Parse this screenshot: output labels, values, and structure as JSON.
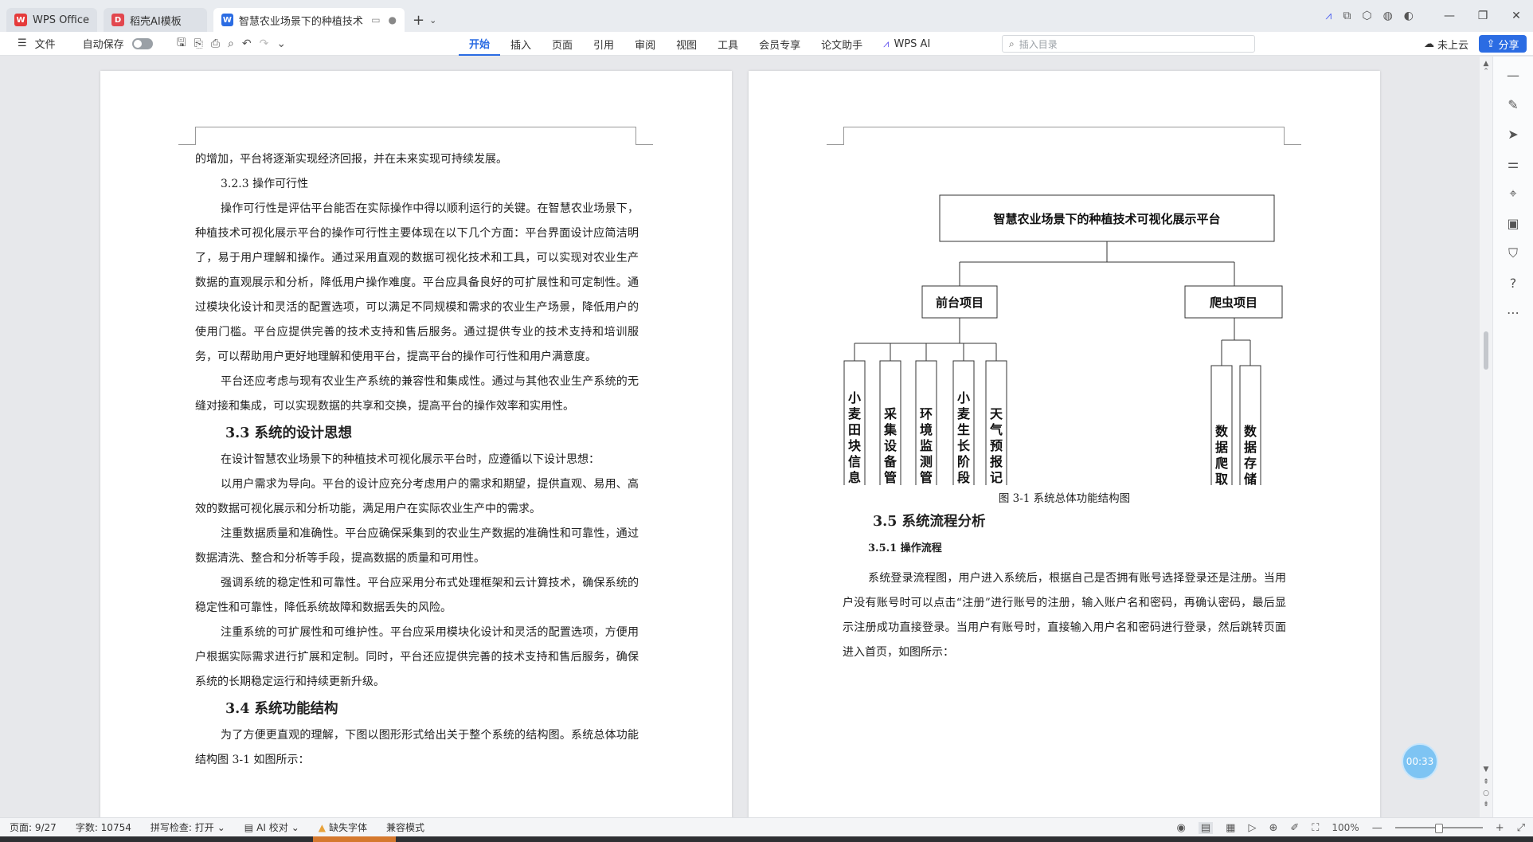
{
  "tabs": [
    {
      "label": "WPS Office",
      "icon": "wps-icon",
      "color": "#e53a3a",
      "active": false
    },
    {
      "label": "稻壳AI模板",
      "icon": "docer-icon",
      "color": "#e2474e",
      "active": false
    },
    {
      "label": "智慧农业场景下的种植技术可",
      "icon": "word-icon",
      "color": "#2b6ce3",
      "active": true
    }
  ],
  "menubar": {
    "file_label": "文件",
    "autosave_label": "自动保存",
    "tabs": [
      "开始",
      "插入",
      "页面",
      "引用",
      "审阅",
      "视图",
      "工具",
      "会员专享",
      "论文助手",
      "WPS AI"
    ],
    "active_tab": "开始",
    "search_placeholder": "插入目录",
    "cloud_label": "未上云",
    "share_label": "分享"
  },
  "left_page": {
    "p1": "的增加，平台将逐渐实现经济回报，并在未来实现可持续发展。",
    "sub_323": "3.2.3 操作可行性",
    "p2": "操作可行性是评估平台能否在实际操作中得以顺利运行的关键。在智慧农业场景下，种植技术可视化展示平台的操作可行性主要体现在以下几个方面：平台界面设计应简洁明了，易于用户理解和操作。通过采用直观的数据可视化技术和工具，可以实现对农业生产数据的直观展示和分析，降低用户操作难度。平台应具备良好的可扩展性和可定制性。通过模块化设计和灵活的配置选项，可以满足不同规模和需求的农业生产场景，降低用户的使用门槛。平台应提供完善的技术支持和售后服务。通过提供专业的技术支持和培训服务，可以帮助用户更好地理解和使用平台，提高平台的操作可行性和用户满意度。",
    "p3": "平台还应考虑与现有农业生产系统的兼容性和集成性。通过与其他农业生产系统的无缝对接和集成，可以实现数据的共享和交换，提高平台的操作效率和实用性。",
    "h_33": "3.3 系统的设计思想",
    "p4": "在设计智慧农业场景下的种植技术可视化展示平台时，应遵循以下设计思想：",
    "p5": "以用户需求为导向。平台的设计应充分考虑用户的需求和期望，提供直观、易用、高效的数据可视化展示和分析功能，满足用户在实际农业生产中的需求。",
    "p6": "注重数据质量和准确性。平台应确保采集到的农业生产数据的准确性和可靠性，通过数据清洗、整合和分析等手段，提高数据的质量和可用性。",
    "p7": "强调系统的稳定性和可靠性。平台应采用分布式处理框架和云计算技术，确保系统的稳定性和可靠性，降低系统故障和数据丢失的风险。",
    "p8": "注重系统的可扩展性和可维护性。平台应采用模块化设计和灵活的配置选项，方便用户根据实际需求进行扩展和定制。同时，平台还应提供完善的技术支持和售后服务，确保系统的长期稳定运行和持续更新升级。",
    "h_34": "3.4 系统功能结构",
    "p9": "为了方便更直观的理解，下图以图形形式给出关于整个系统的结构图。系统总体功能结构图 3-1 如图所示："
  },
  "diagram": {
    "root": "智慧农业场景下的种植技术可视化展示平台",
    "branch_front": "前台项目",
    "branch_crawler": "爬虫项目",
    "front_leaves": [
      "小麦田块信息管理",
      "采集设备管理",
      "环境监测管理",
      "小麦生长阶段记录",
      "天气预报记录"
    ],
    "crawler_leaves": [
      "数据爬取",
      "数据存储"
    ],
    "caption": "图 3-1 系统总体功能结构图"
  },
  "right_page": {
    "h_35": "3.5 系统流程分析",
    "h_351": "3.5.1 操作流程",
    "p1": "系统登录流程图，用户进入系统后，根据自己是否拥有账号选择登录还是注册。当用户没有账号时可以点击“注册”进行账号的注册，输入账户名和密码，再确认密码，最后显示注册成功直接登录。当用户有账号时，直接输入用户名和密码进行登录，然后跳转页面进入首页，如图所示："
  },
  "timer": "00:33",
  "status": {
    "page": "页面: 9/27",
    "words": "字数: 10754",
    "spell": "拼写检查: 打开",
    "ai_check": "AI 校对",
    "missing_font": "缺失字体",
    "compat": "兼容模式",
    "zoom": "100%"
  }
}
